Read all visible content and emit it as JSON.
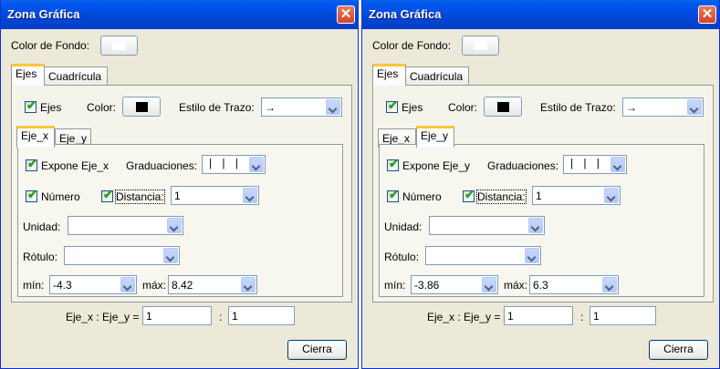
{
  "windows": [
    {
      "title": "Zona Gráfica",
      "close_glyph": "✕",
      "background_color_label": "Color de Fondo:",
      "tabs": [
        "Ejes",
        "Cuadrícula"
      ],
      "axes_checkbox": "Ejes",
      "color_label": "Color:",
      "line_style_label": "Estilo de Trazo:",
      "line_style_value": "→",
      "axis_tabs": [
        "Eje_x",
        "Eje_y"
      ],
      "selected_axis_tab": "Eje_x",
      "show_axis_label": "Expone Eje_x",
      "graduations_label": "Graduaciones:",
      "graduations_value": "| | |",
      "number_label": "Número",
      "distance_label": "Distancia:",
      "distance_value": "1",
      "unit_label": "Unidad:",
      "unit_value": "",
      "label_label": "Rótulo:",
      "label_value": "",
      "min_label": "mín:",
      "min_value": "-4.3",
      "max_label": "máx:",
      "max_value": "8.42",
      "ratio_label": "Eje_x : Eje_y =",
      "ratio_x": "1",
      "ratio_sep": ":",
      "ratio_y": "1",
      "close_button": "Cierra"
    },
    {
      "title": "Zona Gráfica",
      "close_glyph": "✕",
      "background_color_label": "Color de Fondo:",
      "tabs": [
        "Ejes",
        "Cuadrícula"
      ],
      "axes_checkbox": "Ejes",
      "color_label": "Color:",
      "line_style_label": "Estilo de Trazo:",
      "line_style_value": "→",
      "axis_tabs": [
        "Eje_x",
        "Eje_y"
      ],
      "selected_axis_tab": "Eje_y",
      "show_axis_label": "Expone Eje_y",
      "graduations_label": "Graduaciones:",
      "graduations_value": "| | |",
      "number_label": "Número",
      "distance_label": "Distancia:",
      "distance_value": "1",
      "unit_label": "Unidad:",
      "unit_value": "",
      "label_label": "Rótulo:",
      "label_value": "",
      "min_label": "mín:",
      "min_value": "-3.86",
      "max_label": "máx:",
      "max_value": "6.3",
      "ratio_label": "Eje_x : Eje_y =",
      "ratio_x": "1",
      "ratio_sep": ":",
      "ratio_y": "1",
      "close_button": "Cierra"
    }
  ],
  "colors": {
    "titlebar": "#0054e3",
    "axis_color": "#000000",
    "background_swatch": "#ffffff",
    "tab_highlight": "#ffc73c",
    "checkmark": "#21a121"
  }
}
